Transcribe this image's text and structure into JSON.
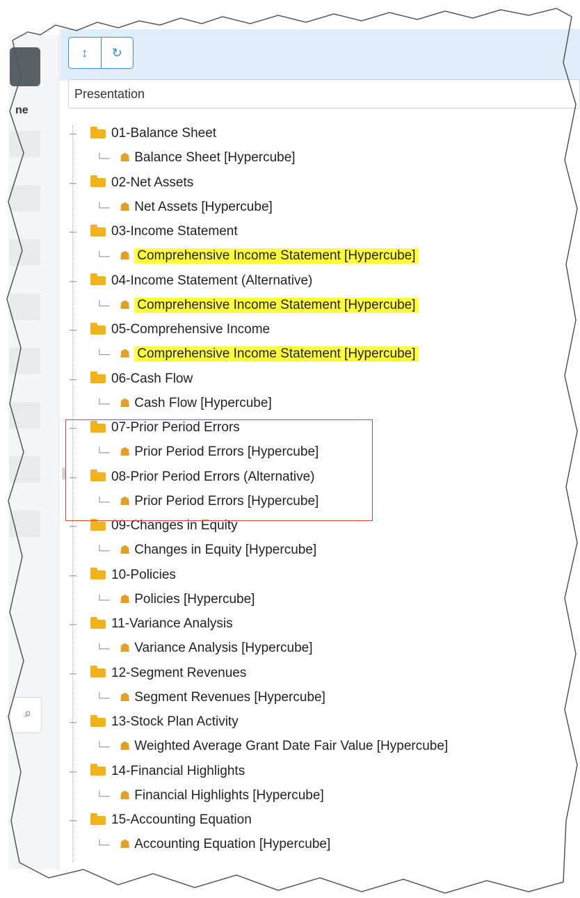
{
  "toolbar": {
    "collapse_icon": "collapse-icon",
    "refresh_icon": "refresh-icon"
  },
  "network_select": {
    "value": "Presentation"
  },
  "left_panel": {
    "label": "ne",
    "search_icon": "search-icon"
  },
  "tree": [
    {
      "label": "01-Balance Sheet",
      "child": "Balance Sheet [Hypercube]",
      "highlight": false
    },
    {
      "label": "02-Net Assets",
      "child": "Net Assets [Hypercube]",
      "highlight": false
    },
    {
      "label": "03-Income Statement",
      "child": "Comprehensive Income Statement [Hypercube]",
      "highlight": true
    },
    {
      "label": "04-Income Statement (Alternative)",
      "child": "Comprehensive Income Statement [Hypercube]",
      "highlight": true
    },
    {
      "label": "05-Comprehensive Income",
      "child": "Comprehensive Income Statement [Hypercube]",
      "highlight": true
    },
    {
      "label": "06-Cash Flow",
      "child": "Cash Flow [Hypercube]",
      "highlight": false
    },
    {
      "label": "07-Prior Period Errors",
      "child": "Prior Period Errors [Hypercube]",
      "highlight": false
    },
    {
      "label": "08-Prior Period Errors (Alternative)",
      "child": "Prior Period Errors [Hypercube]",
      "highlight": false
    },
    {
      "label": "09-Changes in Equity",
      "child": "Changes in Equity [Hypercube]",
      "highlight": false
    },
    {
      "label": "10-Policies",
      "child": "Policies [Hypercube]",
      "highlight": false
    },
    {
      "label": "11-Variance Analysis",
      "child": "Variance Analysis [Hypercube]",
      "highlight": false
    },
    {
      "label": "12-Segment Revenues",
      "child": "Segment Revenues [Hypercube]",
      "highlight": false
    },
    {
      "label": "13-Stock Plan Activity",
      "child": "Weighted Average Grant Date Fair Value [Hypercube]",
      "highlight": false
    },
    {
      "label": "14-Financial Highlights",
      "child": "Financial Highlights [Hypercube]",
      "highlight": false
    },
    {
      "label": "15-Accounting Equation",
      "child": "Accounting Equation [Hypercube]",
      "highlight": false
    }
  ],
  "colors": {
    "folder": "#f2b21a",
    "highlight": "#ffff3a",
    "selection_border": "#e04040",
    "accent": "#2f8ce0"
  }
}
